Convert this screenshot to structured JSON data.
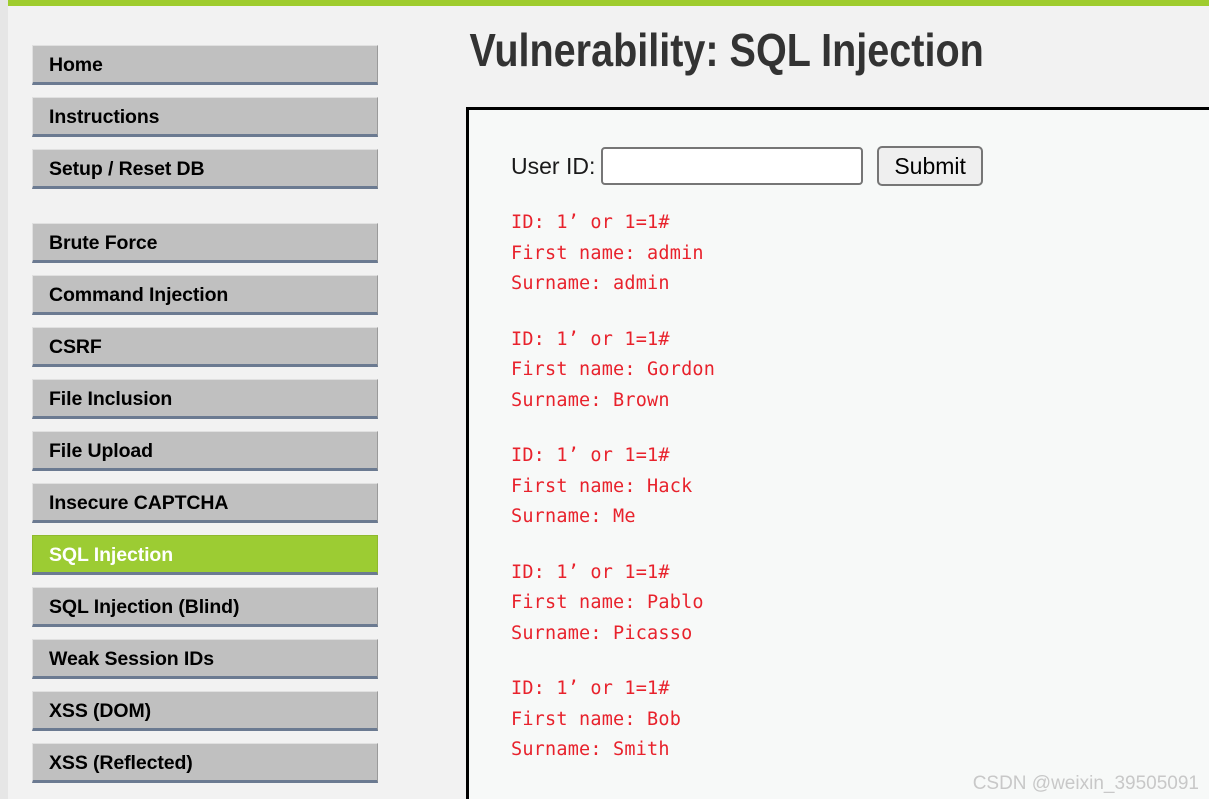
{
  "theme": {
    "top_bar_color": "#9fcc2e",
    "nav_bg_color": "#c0c0c0",
    "nav_active_color": "#9ccc33",
    "result_text_color": "#e8222c",
    "content_bg_color": "#f7f9f8"
  },
  "sidebar": {
    "groups": [
      {
        "items": [
          {
            "label": "Home",
            "active": false
          },
          {
            "label": "Instructions",
            "active": false
          },
          {
            "label": "Setup / Reset DB",
            "active": false
          }
        ]
      },
      {
        "items": [
          {
            "label": "Brute Force",
            "active": false
          },
          {
            "label": "Command Injection",
            "active": false
          },
          {
            "label": "CSRF",
            "active": false
          },
          {
            "label": "File Inclusion",
            "active": false
          },
          {
            "label": "File Upload",
            "active": false
          },
          {
            "label": "Insecure CAPTCHA",
            "active": false
          },
          {
            "label": "SQL Injection",
            "active": true
          },
          {
            "label": "SQL Injection (Blind)",
            "active": false
          },
          {
            "label": "Weak Session IDs",
            "active": false
          },
          {
            "label": "XSS (DOM)",
            "active": false
          },
          {
            "label": "XSS (Reflected)",
            "active": false
          }
        ]
      }
    ]
  },
  "main": {
    "title": "Vulnerability: SQL Injection",
    "form": {
      "label": "User ID:",
      "input_value": "",
      "input_placeholder": "",
      "submit_label": "Submit"
    },
    "results": [
      {
        "id_line": "ID: 1’ or 1=1#",
        "first_name_line": "First name: admin",
        "surname_line": "Surname: admin"
      },
      {
        "id_line": "ID: 1’ or 1=1#",
        "first_name_line": "First name: Gordon",
        "surname_line": "Surname: Brown"
      },
      {
        "id_line": "ID: 1’ or 1=1#",
        "first_name_line": "First name: Hack",
        "surname_line": "Surname: Me"
      },
      {
        "id_line": "ID: 1’ or 1=1#",
        "first_name_line": "First name: Pablo",
        "surname_line": "Surname: Picasso"
      },
      {
        "id_line": "ID: 1’ or 1=1#",
        "first_name_line": "First name: Bob",
        "surname_line": "Surname: Smith"
      }
    ]
  },
  "watermark": {
    "text": "CSDN @weixin_39505091"
  }
}
